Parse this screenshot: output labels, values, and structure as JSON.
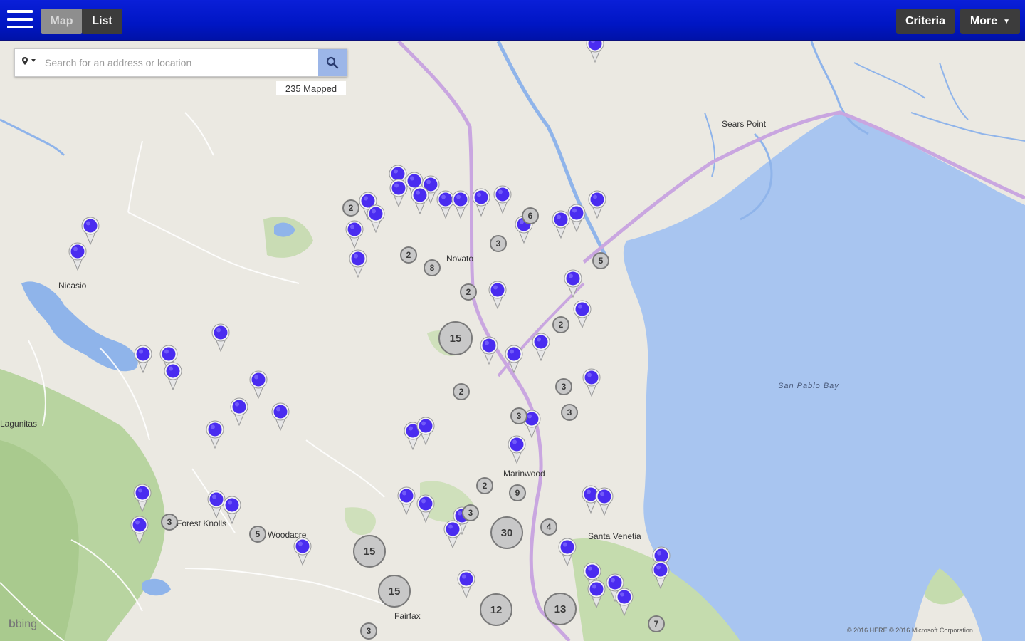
{
  "topbar": {
    "menu_icon": "hamburger-icon",
    "tab_map": "Map",
    "tab_list": "List",
    "criteria": "Criteria",
    "more": "More",
    "more_caret": "▼"
  },
  "search": {
    "placeholder": "Search for an address or location",
    "location_icon": "map-pin-icon",
    "search_icon": "magnifier-icon",
    "mapped_count": "235 Mapped"
  },
  "places": [
    {
      "name": "Nicasio"
    },
    {
      "name": "Novato"
    },
    {
      "name": "Sears Point"
    },
    {
      "name": "Marinwood"
    },
    {
      "name": "Santa Venetia"
    },
    {
      "name": "Fairfax"
    },
    {
      "name": "Woodacre"
    },
    {
      "name": "Forest Knolls"
    },
    {
      "name": "Lagunitas"
    }
  ],
  "water_labels": [
    {
      "name": "San Pablo Bay"
    }
  ],
  "clusters": [
    "2",
    "6",
    "3",
    "2",
    "8",
    "5",
    "2",
    "15",
    "2",
    "2",
    "3",
    "3",
    "3",
    "2",
    "9",
    "3",
    "4",
    "30",
    "15",
    "15",
    "12",
    "13",
    "3",
    "5",
    "7",
    "3"
  ],
  "map_footer": {
    "bing": "bing",
    "copyright": "© 2016 HERE   © 2016 Microsoft Corporation"
  },
  "colors": {
    "topbar": "#0016c4",
    "pin": "#4a2cf0",
    "cluster": "#c8c8c8",
    "water": "#a8c5f0"
  }
}
